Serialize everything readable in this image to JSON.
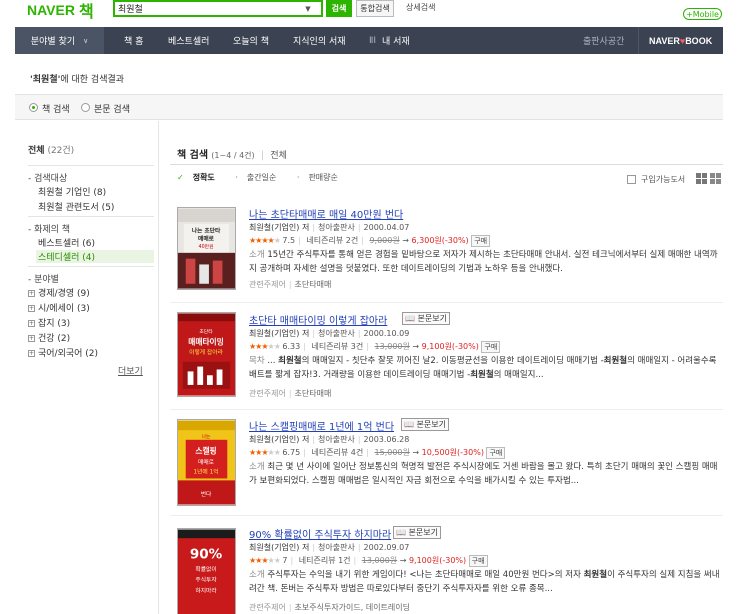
{
  "brand": {
    "logo_text": "NAVER",
    "logo_suffix": "책"
  },
  "search": {
    "query": "최원철",
    "search_btn": "검색",
    "total_btn": "통합검색",
    "advanced": "상세검색",
    "dropdown_icon": "chevron-down-icon"
  },
  "mobile_btn": "+Mobile",
  "nav": {
    "category": "분야별 찾기",
    "items": [
      "책 홈",
      "베스트셀러",
      "오늘의 책",
      "지식인의 서재",
      "내 서재"
    ],
    "publisher": "출판사공간",
    "naver_book_left": "NAVER",
    "naver_book_right": "BOOK"
  },
  "result_header": {
    "query": "'최원철'",
    "suffix": "에 대한 검색결과"
  },
  "tabs": [
    "책 검색",
    "본문 검색"
  ],
  "sidebar": {
    "all_label": "전체",
    "all_count": "(22건)",
    "target_title": "검색대상",
    "target_items": [
      "최원철 기업인 (8)",
      "최원철 관련도서 (5)"
    ],
    "topic_title": "화제의 책",
    "topic_items": [
      "베스트셀러 (6)",
      "스테디셀러 (4)"
    ],
    "field_title": "분야별",
    "field_items": [
      "경제/경영 (9)",
      "시/에세이 (3)",
      "잡지 (3)",
      "건강 (2)",
      "국어/외국어 (2)"
    ],
    "more": "더보기"
  },
  "main": {
    "section_title": "책 검색",
    "section_count": "(1~4 / 4건)",
    "all_link": "전체",
    "sorts": [
      "정확도",
      "출간일순",
      "판매량순"
    ],
    "available": "구입가능도서",
    "preview_label": "본문보기",
    "buy_label": "구매",
    "topic_label": "관련주제어",
    "desc_label": "소개",
    "toc_label": "목차",
    "books": [
      {
        "title": "나는 초단타매매로 매일 40만원 번다",
        "author": "최원철(기업인) 저",
        "publisher": "청아출판사",
        "date": "2000.04.07",
        "rating": "7.5",
        "reviews": "네티즌리뷰 2건",
        "price": "9,000원",
        "sale": "6,300원(-30%)",
        "has_preview": false,
        "desc_label": "소개",
        "desc": "15년간 주식투자를 통해 얻은 경험을 밑바탕으로 저자가 제시하는 초단타매매 안내서. 실전 테크닉에서부터 실제 매매한 내역까지 공개하며 자세한 설명을 덧붙였다. 또한 데이트레이딩의 기법과 노하우 등을 안내했다.",
        "topics": "초단타매매",
        "cover_text": "나는 초단타매매로 매일 40만원 번다",
        "stars": 4
      },
      {
        "title": "초단타 매매타이밍 이렇게 잡아라",
        "author": "최원철(기업인) 저",
        "publisher": "청아출판사",
        "date": "2000.10.09",
        "rating": "6.33",
        "reviews": "네티즌리뷰 3건",
        "price": "13,000원",
        "sale": "9,100원(-30%)",
        "has_preview": true,
        "desc_label": "목차",
        "desc_pre": "... ",
        "desc_b1": "최원철",
        "desc_mid1": "의 매매일지 - 칫단추 잘못 끼어진 날2. 이동평균선을 이용한 데이트레이딩 매매기법 -",
        "desc_b2": "최원철",
        "desc_mid2": "의 매매일지 - 어려울수록 배트를 짧게 잡자!3. 거래량을 이용한 데이트레이딩 매매기법 -",
        "desc_b3": "최원철",
        "desc_post": "의 매매일지...",
        "topics": "초단타매매",
        "cover_text": "초단타 매매타이밍 이렇게 잡아라",
        "stars": 3
      },
      {
        "title": "나는 스캘핑매매로 1년에 1억 번다",
        "author": "최원철(기업인) 저",
        "publisher": "청아출판사",
        "date": "2003.06.28",
        "rating": "6.75",
        "reviews": "네티즌리뷰 4건",
        "price": "15,000원",
        "sale": "10,500원(-30%)",
        "has_preview": true,
        "desc_label": "소개",
        "desc": "최근 몇 년 사이에 일어난 정보통신의 혁명적 발전은 주식시장에도 거센 바람을 몰고 왔다. 특히 초단기 매매의 꽃인 스캘핑 매매가 보편화되었다. 스캘핑 매매법은 일시적인 자금 회전으로 수익을 배가시킬 수 있는 투자법...",
        "topics": "초단타매매",
        "cover_text": "나는 스캘핑 매매로 1년에 1억 번다",
        "stars": 3
      },
      {
        "title": "90% 확률없이 주식투자 하지마라",
        "author": "최원철(기업인) 저",
        "publisher": "청아출판사",
        "date": "2002.09.07",
        "rating": "7",
        "reviews": "네티즌리뷰 1건",
        "price": "13,000원",
        "sale": "9,100원(-30%)",
        "has_preview": true,
        "desc_label": "소개",
        "desc_pre": "주식투자는 수익을 내기 위한 게임이다! <나는 초단타매매로 매일 40만원 번다>의 저자 ",
        "desc_b1": "최원철",
        "desc_post": "이 주식투자의 실제 지침을 써내려간 책. 돈버는 주식투자 방법은 따로있다부터 중단기 주식투자자를 위한 오류 종목...",
        "topics": "초보주식투자가이드, 데이트레이딩",
        "cover_text": "90% 확률없이 주식투자 하지마라",
        "stars": 3
      }
    ]
  },
  "colors": {
    "brand_green": "#2db400",
    "nav_bg": "#3b4352",
    "link_blue": "#2440b8",
    "sale_red": "#e02020"
  }
}
